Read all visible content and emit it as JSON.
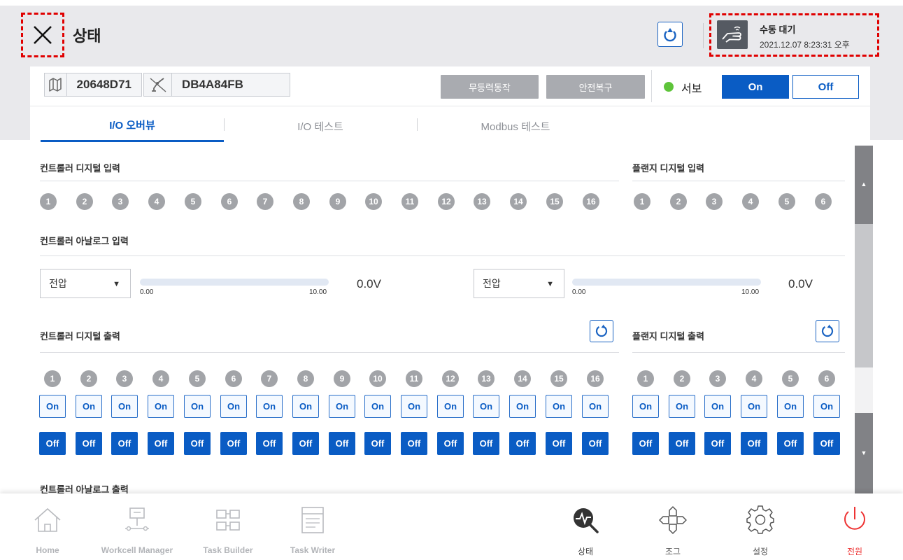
{
  "header": {
    "title": "상태",
    "status_mode": "수동 대기",
    "status_time": "2021.12.07 8:23:31 오후"
  },
  "card": {
    "controller_id": "20648D71",
    "flange_id": "DB4A84FB",
    "btn_freedrive": "무등력동작",
    "btn_safety_recovery": "안전복구",
    "servo_label": "서보",
    "servo_on": "On",
    "servo_off": "Off",
    "tabs": [
      {
        "label": "I/O 오버뷰",
        "active": true
      },
      {
        "label": "I/O 테스트",
        "active": false
      },
      {
        "label": "Modbus 테스트",
        "active": false
      }
    ]
  },
  "sections": {
    "ctrl_digital_in": "컨트롤러 디지털 입력",
    "flange_digital_in": "플랜지 디지털 입력",
    "ctrl_analog_in": "컨트롤러 아날로그 입력",
    "ctrl_digital_out": "컨트롤러 디지털 출력",
    "flange_digital_out": "플랜지 디지털 출력",
    "ctrl_analog_out": "컨트롤러 아날로그 출력"
  },
  "io_numbers": {
    "controller": [
      "1",
      "2",
      "3",
      "4",
      "5",
      "6",
      "7",
      "8",
      "9",
      "10",
      "11",
      "12",
      "13",
      "14",
      "15",
      "16"
    ],
    "flange": [
      "1",
      "2",
      "3",
      "4",
      "5",
      "6"
    ]
  },
  "output_labels": {
    "on": "On",
    "off": "Off"
  },
  "analog_in": [
    {
      "mode": "전압",
      "min": "0.00",
      "max": "10.00",
      "value": "0.0V",
      "level": 0.0
    },
    {
      "mode": "전압",
      "min": "0.00",
      "max": "10.00",
      "value": "0.0V",
      "level": 0.0
    }
  ],
  "nav": {
    "home": "Home",
    "workcell": "Workcell Manager",
    "task_builder": "Task Builder",
    "task_writer": "Task Writer",
    "status": "상태",
    "jog": "조그",
    "settings": "설정",
    "power": "전원"
  },
  "colors": {
    "accent": "#0a5cc4",
    "servo_indicator": "#5ec43a",
    "power": "#e33333",
    "highlight_box": "#e00000"
  }
}
